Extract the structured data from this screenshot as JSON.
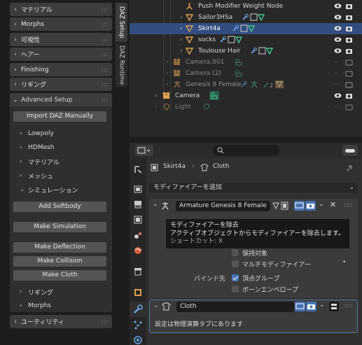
{
  "left_panel": {
    "collapsed_top": [
      "マテリアル",
      "Morphs",
      "可視性",
      "ヘアー",
      "Finishing",
      "リギング"
    ],
    "advanced": {
      "title": "Advanced Setup",
      "import_button": "Import DAZ Manually",
      "subs": [
        "Lowpoly",
        "HDMesh",
        "マテリアル",
        "メッシュ"
      ],
      "simulation": "シミュレーション",
      "buttons": [
        "Add Softbody",
        "Make Simulation",
        "Make Deflection",
        "Make Collision",
        "Make Cloth"
      ],
      "subs_after": [
        "リギング",
        "Morphs"
      ]
    },
    "utility": "ユーティリティ"
  },
  "vertical_tabs": [
    "DAZ Setup",
    "DAZ Runtime"
  ],
  "outliner": {
    "rows": [
      {
        "label": "Push Modifier Weight Node",
        "type": "modifier"
      },
      {
        "label": "Sailor3HSa",
        "type": "mesh"
      },
      {
        "label": "Skirt4a",
        "type": "mesh",
        "selected": true
      },
      {
        "label": "socks",
        "type": "mesh"
      },
      {
        "label": "Toulouse Hair",
        "type": "mesh"
      },
      {
        "label": "Camera.001",
        "type": "camera",
        "dim": true
      },
      {
        "label": "Camera (2)",
        "type": "camera",
        "dim": true
      },
      {
        "label": "Genesis 8 Female",
        "type": "armature",
        "dim": true
      },
      {
        "label": "Camera",
        "type": "camera"
      },
      {
        "label": "Light",
        "type": "light",
        "dim": true
      }
    ]
  },
  "properties": {
    "breadcrumb_object": "Skirt4a",
    "breadcrumb_data": "Cloth",
    "add_modifier": "モディファイアーを追加",
    "armature": {
      "name": "Armature Genesis 8 Female"
    },
    "tooltip": {
      "title": "モディファイアーを除去",
      "desc": "アクティブオブジェクトからモディファイアーを除去します。",
      "shortcut": "ショートカット: X"
    },
    "partial_option": "保持対象",
    "multi_modifier": "マルチモディファイアー",
    "bind_label": "バインド先",
    "vertex_group": "頂点グループ",
    "bone_envelope": "ボーンエンベロープ",
    "cloth": {
      "name": "Cloth",
      "note": "設定は物理演算タブにあります"
    }
  },
  "colors": {
    "accent": "#4772b3",
    "selected_row": "#334d80",
    "mesh": "#e0a050",
    "data_green": "#3fc58d"
  }
}
